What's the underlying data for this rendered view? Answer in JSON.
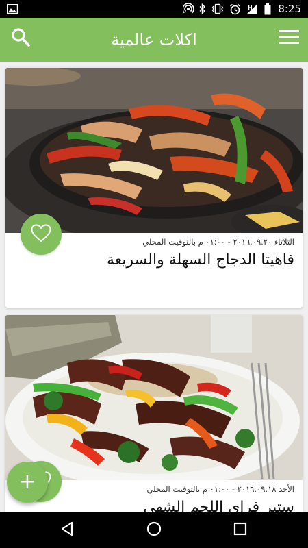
{
  "status_bar": {
    "time": "8:25",
    "icons": [
      "image-icon",
      "hotspot-icon",
      "bluetooth-icon",
      "vibrate-icon",
      "alarm-icon",
      "signal-icon",
      "battery-icon"
    ]
  },
  "app_bar": {
    "title": "اكلات عالمية",
    "background": "#84bf5e",
    "left_icon": "search-icon",
    "right_icon": "menu-icon"
  },
  "cards": [
    {
      "meta": "الثلاثاء ٢٠١٦.٠٩.٢٠ - ٠١:٠٠ م بالتوقيت المحلي",
      "title": "فاهيتا الدجاج السهلة والسريعة",
      "image": "chicken-fajita-photo",
      "favorite_icon": "heart-icon"
    },
    {
      "meta": "الأحد ٢٠١٦.٠٩.١٨ - ٠١:٠٠ م بالتوقيت المحلي",
      "title": "ستير فراي اللحم الشهي",
      "image": "beef-stir-fry-photo",
      "favorite_icon": "heart-icon"
    }
  ],
  "fab": {
    "label": "+",
    "icon": "add-icon"
  },
  "nav_bar": {
    "icons": [
      "back-icon",
      "home-icon",
      "recents-icon"
    ]
  }
}
